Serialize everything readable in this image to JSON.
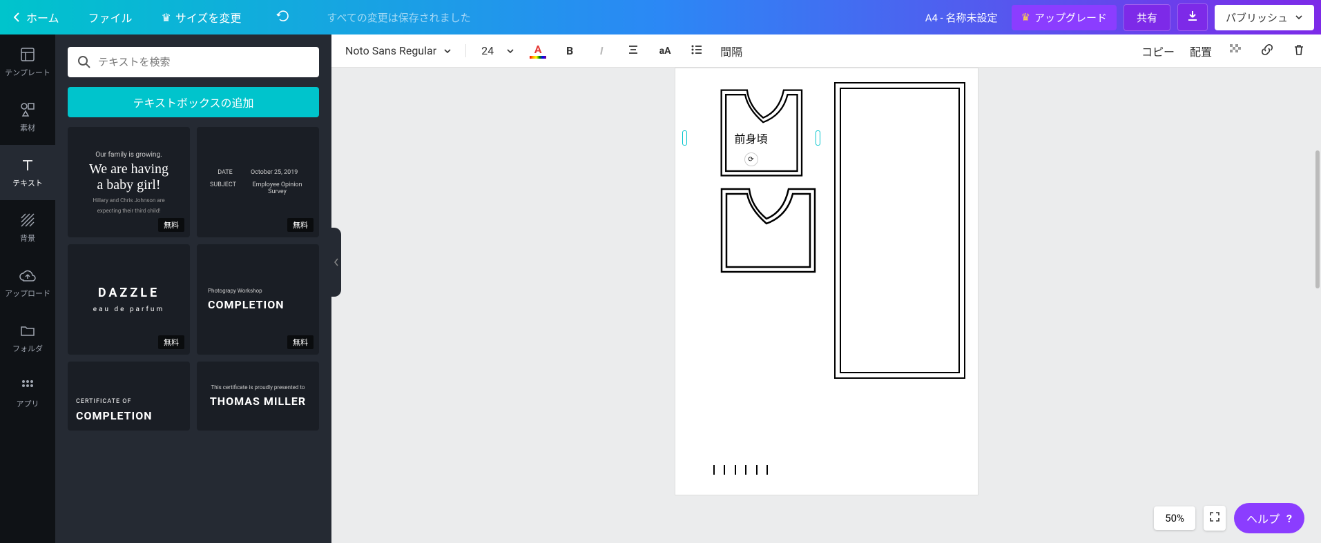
{
  "topbar": {
    "home": "ホーム",
    "file": "ファイル",
    "resize": "サイズを変更",
    "save_status": "すべての変更は保存されました",
    "doc_title": "A4 - 名称未設定",
    "upgrade": "アップグレード",
    "share": "共有",
    "publish": "パブリッシュ"
  },
  "rail": {
    "template": "テンプレート",
    "elements": "素材",
    "text": "テキスト",
    "background": "背景",
    "upload": "アップロード",
    "folder": "フォルダ",
    "apps": "アプリ"
  },
  "panel": {
    "search_placeholder": "テキストを検索",
    "add_text": "テキストボックスの追加",
    "free": "無料",
    "templates": {
      "baby": {
        "line1": "Our family is growing.",
        "line2": "We are having",
        "line3": "a baby girl!",
        "line4": "Hillary and Chris Johnson are",
        "line5": "expecting their third child!"
      },
      "memo": {
        "date_l": "DATE",
        "date_v": "October 25, 2019",
        "subj_l": "SUBJECT",
        "subj_v": "Employee Opinion Survey"
      },
      "dazzle": {
        "title": "DAZZLE",
        "sub": "eau de parfum"
      },
      "completion": {
        "pre": "Photograpy Workshop",
        "title": "COMPLETION"
      },
      "cert": {
        "pre": "CERTIFICATE OF",
        "title": "COMPLETION"
      },
      "thomas": {
        "pre": "This certificate is proudly presented to",
        "title": "THOMAS MILLER"
      }
    }
  },
  "toolbar": {
    "font": "Noto Sans Regular",
    "size": "24",
    "spacing": "間隔",
    "copy": "コピー",
    "position": "配置"
  },
  "canvas": {
    "selected_text": "前身頃"
  },
  "footer": {
    "zoom": "50%",
    "help": "ヘルプ"
  }
}
